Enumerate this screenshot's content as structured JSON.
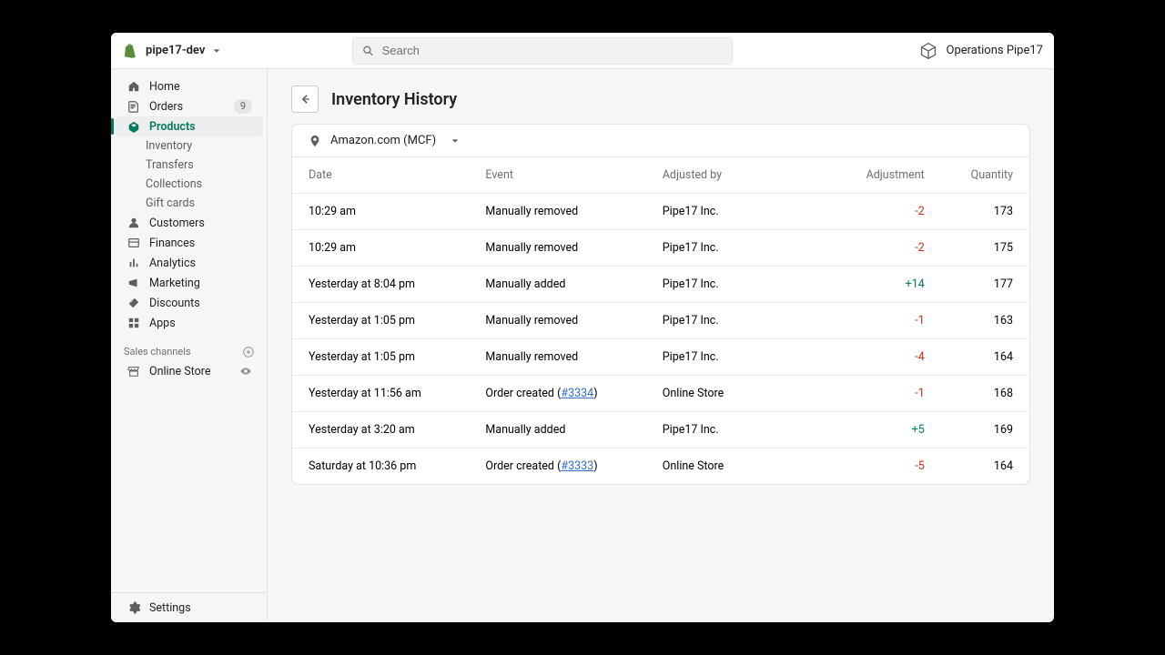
{
  "topbar": {
    "store_name": "pipe17-dev",
    "search_placeholder": "Search",
    "org_name": "Operations Pipe17"
  },
  "sidebar": {
    "items": [
      {
        "icon": "home",
        "label": "Home"
      },
      {
        "icon": "orders",
        "label": "Orders",
        "badge": "9"
      },
      {
        "icon": "products",
        "label": "Products",
        "selected": true,
        "subs": [
          "Inventory",
          "Transfers",
          "Collections",
          "Gift cards"
        ]
      },
      {
        "icon": "customers",
        "label": "Customers"
      },
      {
        "icon": "finances",
        "label": "Finances"
      },
      {
        "icon": "analytics",
        "label": "Analytics"
      },
      {
        "icon": "marketing",
        "label": "Marketing"
      },
      {
        "icon": "discounts",
        "label": "Discounts"
      },
      {
        "icon": "apps",
        "label": "Apps"
      }
    ],
    "channels_heading": "Sales channels",
    "channels": [
      {
        "icon": "store",
        "label": "Online Store"
      }
    ],
    "settings_label": "Settings"
  },
  "page": {
    "title": "Inventory History",
    "location": "Amazon.com (MCF)",
    "columns": {
      "date": "Date",
      "event": "Event",
      "adjusted_by": "Adjusted by",
      "adjustment": "Adjustment",
      "quantity": "Quantity"
    },
    "rows": [
      {
        "date": "10:29 am",
        "event": "Manually removed",
        "by": "Pipe17 Inc.",
        "adj": "-2",
        "adj_sign": "neg",
        "qty": "173"
      },
      {
        "date": "10:29 am",
        "event": "Manually removed",
        "by": "Pipe17 Inc.",
        "adj": "-2",
        "adj_sign": "neg",
        "qty": "175"
      },
      {
        "date": "Yesterday at 8:04 pm",
        "event": "Manually added",
        "by": "Pipe17 Inc.",
        "adj": "+14",
        "adj_sign": "pos",
        "qty": "177"
      },
      {
        "date": "Yesterday at 1:05 pm",
        "event": "Manually removed",
        "by": "Pipe17 Inc.",
        "adj": "-1",
        "adj_sign": "neg",
        "qty": "163"
      },
      {
        "date": "Yesterday at 1:05 pm",
        "event": "Manually removed",
        "by": "Pipe17 Inc.",
        "adj": "-4",
        "adj_sign": "neg",
        "qty": "164"
      },
      {
        "date": "Yesterday at 11:56 am",
        "event_prefix": "Order created (",
        "order": "#3334",
        "event_suffix": ")",
        "by": "Online Store",
        "adj": "-1",
        "adj_sign": "neg",
        "qty": "168"
      },
      {
        "date": "Yesterday at 3:20 am",
        "event": "Manually added",
        "by": "Pipe17 Inc.",
        "adj": "+5",
        "adj_sign": "pos",
        "qty": "169"
      },
      {
        "date": "Saturday at 10:36 pm",
        "event_prefix": "Order created (",
        "order": "#3333",
        "event_suffix": ")",
        "by": "Online Store",
        "adj": "-5",
        "adj_sign": "neg",
        "qty": "164"
      }
    ]
  }
}
